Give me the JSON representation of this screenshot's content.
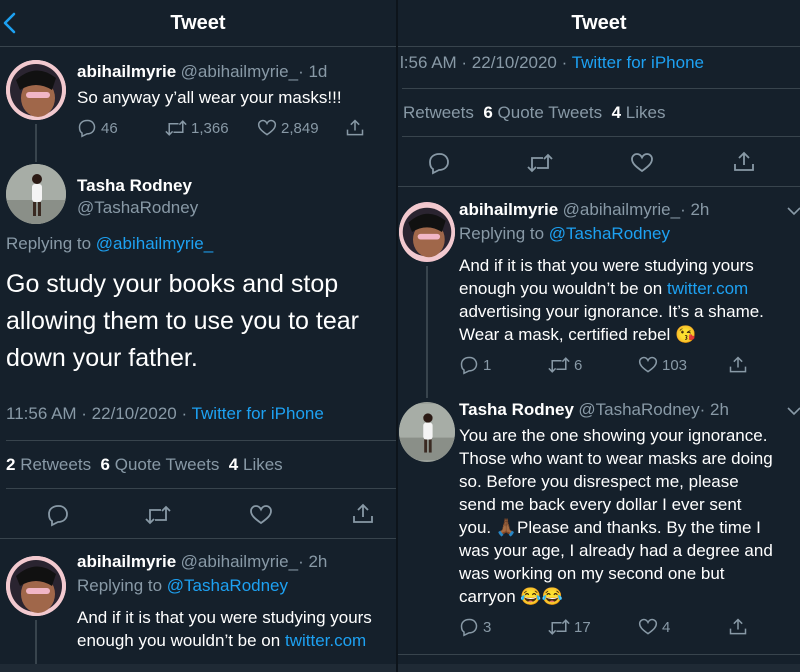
{
  "left": {
    "header": {
      "title": "Tweet"
    },
    "tweet1": {
      "name": "abihailmyrie",
      "handle": "@abihailmyrie_",
      "time": "· 1d",
      "text": "So anyway y’all wear your masks!!!",
      "replies": "46",
      "retweets": "1,366",
      "likes": "2,849"
    },
    "main": {
      "name": "Tasha Rodney",
      "handle": "@TashaRodney",
      "replying_prefix": "Replying to",
      "replying_handle": "@abihailmyrie_",
      "text_line1": "Go study your books and stop",
      "text_line2": "allowing them to use you to tear",
      "text_line3": "down your father.",
      "timestamp": "11:56 AM · 22/10/2020 ·",
      "source": "Twitter for iPhone",
      "retweets_count": "2",
      "retweets_label": "Retweets",
      "quotes_count": "6",
      "quotes_label": "Quote Tweets",
      "likes_count": "4",
      "likes_label": "Likes"
    },
    "reply": {
      "name": "abihailmyrie",
      "handle": "@abihailmyrie_",
      "time": "· 2h",
      "replying_prefix": "Replying to",
      "replying_handle": "@TashaRodney",
      "text_line1": "And if it is that you were studying yours",
      "text_line2_prefix": "enough you wouldn’t be on",
      "text_line2_link": "twitter.com"
    }
  },
  "right": {
    "header": {
      "title": "Tweet"
    },
    "main": {
      "timestamp": "l:56 AM · 22/10/2020 ·",
      "source": "Twitter for iPhone",
      "retweets_label": "Retweets",
      "quotes_count": "6",
      "quotes_label": "Quote Tweets",
      "likes_count": "4",
      "likes_label": "Likes"
    },
    "reply1": {
      "name": "abihailmyrie",
      "handle": "@abihailmyrie_",
      "time": "· 2h",
      "replying_prefix": "Replying to",
      "replying_handle": "@TashaRodney",
      "line1": "And if it is that you were studying yours",
      "line2_prefix": "enough you wouldn’t be on",
      "line2_link": "twitter.com",
      "line3": "advertising your ignorance. It’s a shame.",
      "line4": "Wear a mask, certified rebel",
      "emoji": "😘",
      "replies": "1",
      "retweets": "6",
      "likes": "103"
    },
    "reply2": {
      "name": "Tasha Rodney",
      "handle": "@TashaRodney",
      "time": "· 2h",
      "line1": "You are the one showing your ignorance.",
      "line2": "Those who want to wear masks are doing",
      "line3": "so. Before you disrespect me, please",
      "line4": "send me back every dollar I ever sent",
      "line5_prefix": "you.",
      "line5_emoji": "🙏🏾",
      "line5_suffix": "Please and thanks. By the time I",
      "line6": "was your age, I already had a degree and",
      "line7": "was working on my second one but",
      "line8": "carryon",
      "line8_emoji": "😂😂",
      "replies": "3",
      "retweets": "17",
      "likes": "4"
    }
  },
  "colors": {
    "background": "#15202b",
    "accent": "#1da1f2",
    "muted": "#8899a6",
    "border": "#38444d"
  },
  "icons": [
    "back-arrow-icon",
    "reply-icon",
    "retweet-icon",
    "like-icon",
    "share-icon",
    "chevron-down-icon"
  ]
}
